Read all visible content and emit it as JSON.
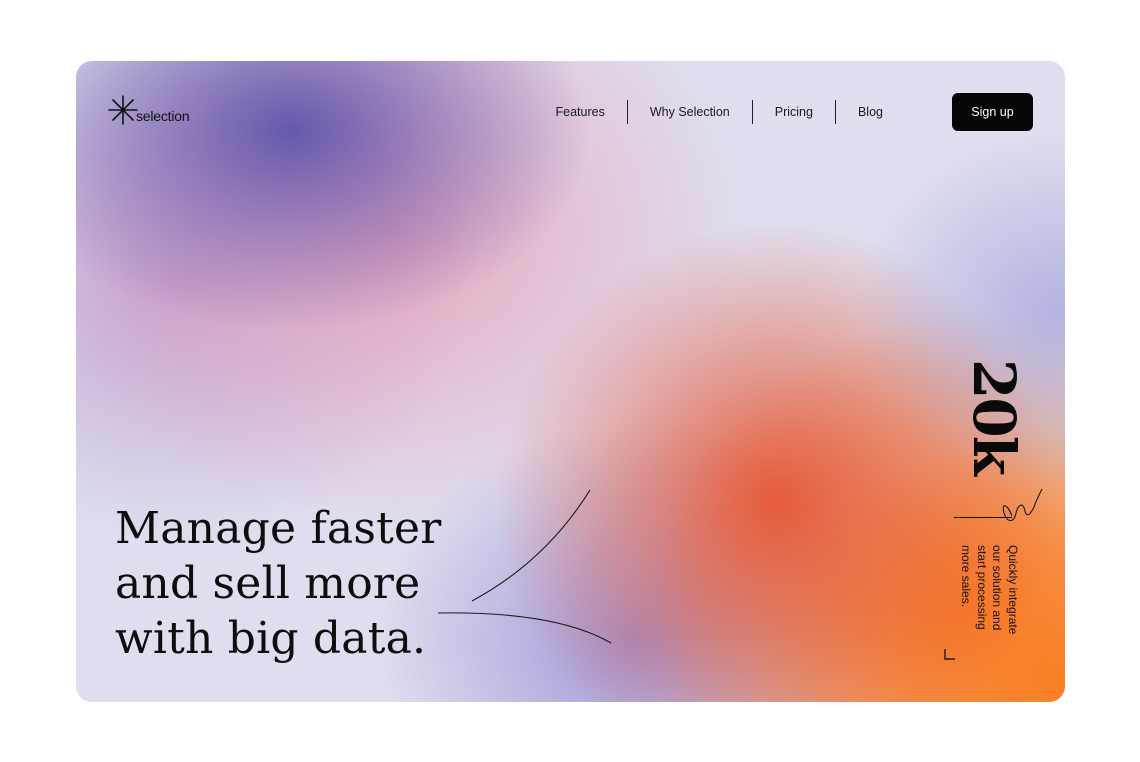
{
  "logo": {
    "icon": "asterisk-icon",
    "text": "selection"
  },
  "nav": {
    "items": [
      {
        "label": "Features"
      },
      {
        "label": "Why Selection"
      },
      {
        "label": "Pricing"
      },
      {
        "label": "Blog"
      }
    ]
  },
  "signup": {
    "label": "Sign up"
  },
  "hero": {
    "lines": [
      "Manage faster",
      "and sell more",
      "with big data."
    ]
  },
  "stat": {
    "value": "20k",
    "description": "Quickly integrate\nour solution and\nstart processing\nmore sales."
  },
  "colors": {
    "button_bg": "#050505",
    "text": "#0d0d0d",
    "purple": "#6053aa",
    "pink": "#e79fb6",
    "red": "#e65634",
    "orange": "#fc8220"
  }
}
